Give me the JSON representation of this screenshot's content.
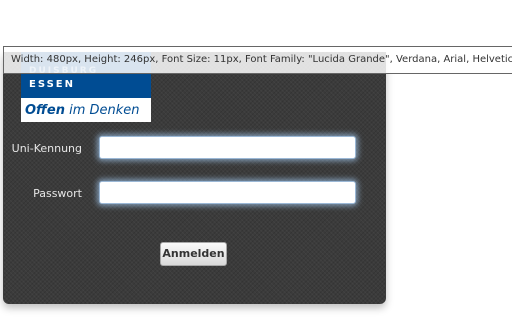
{
  "tooltip": {
    "text": "Width: 480px, Height: 246px, Font Size: 11px, Font Family: \"Lucida Grande\", Verdana, Arial, Helvetica, sans-serif"
  },
  "logo": {
    "line1": "DUISBURG",
    "line2": "ESSEN",
    "slogan_bold": "Offen",
    "slogan_rest": " im Denken"
  },
  "form": {
    "username_label": "Uni-Kennung",
    "username_value": "",
    "password_label": "Passwort",
    "password_value": "",
    "submit_label": "Anmelden"
  },
  "colors": {
    "brand_blue": "#004c93",
    "panel_bg": "#3b3b3b",
    "input_glow": "#a5cdf5"
  }
}
